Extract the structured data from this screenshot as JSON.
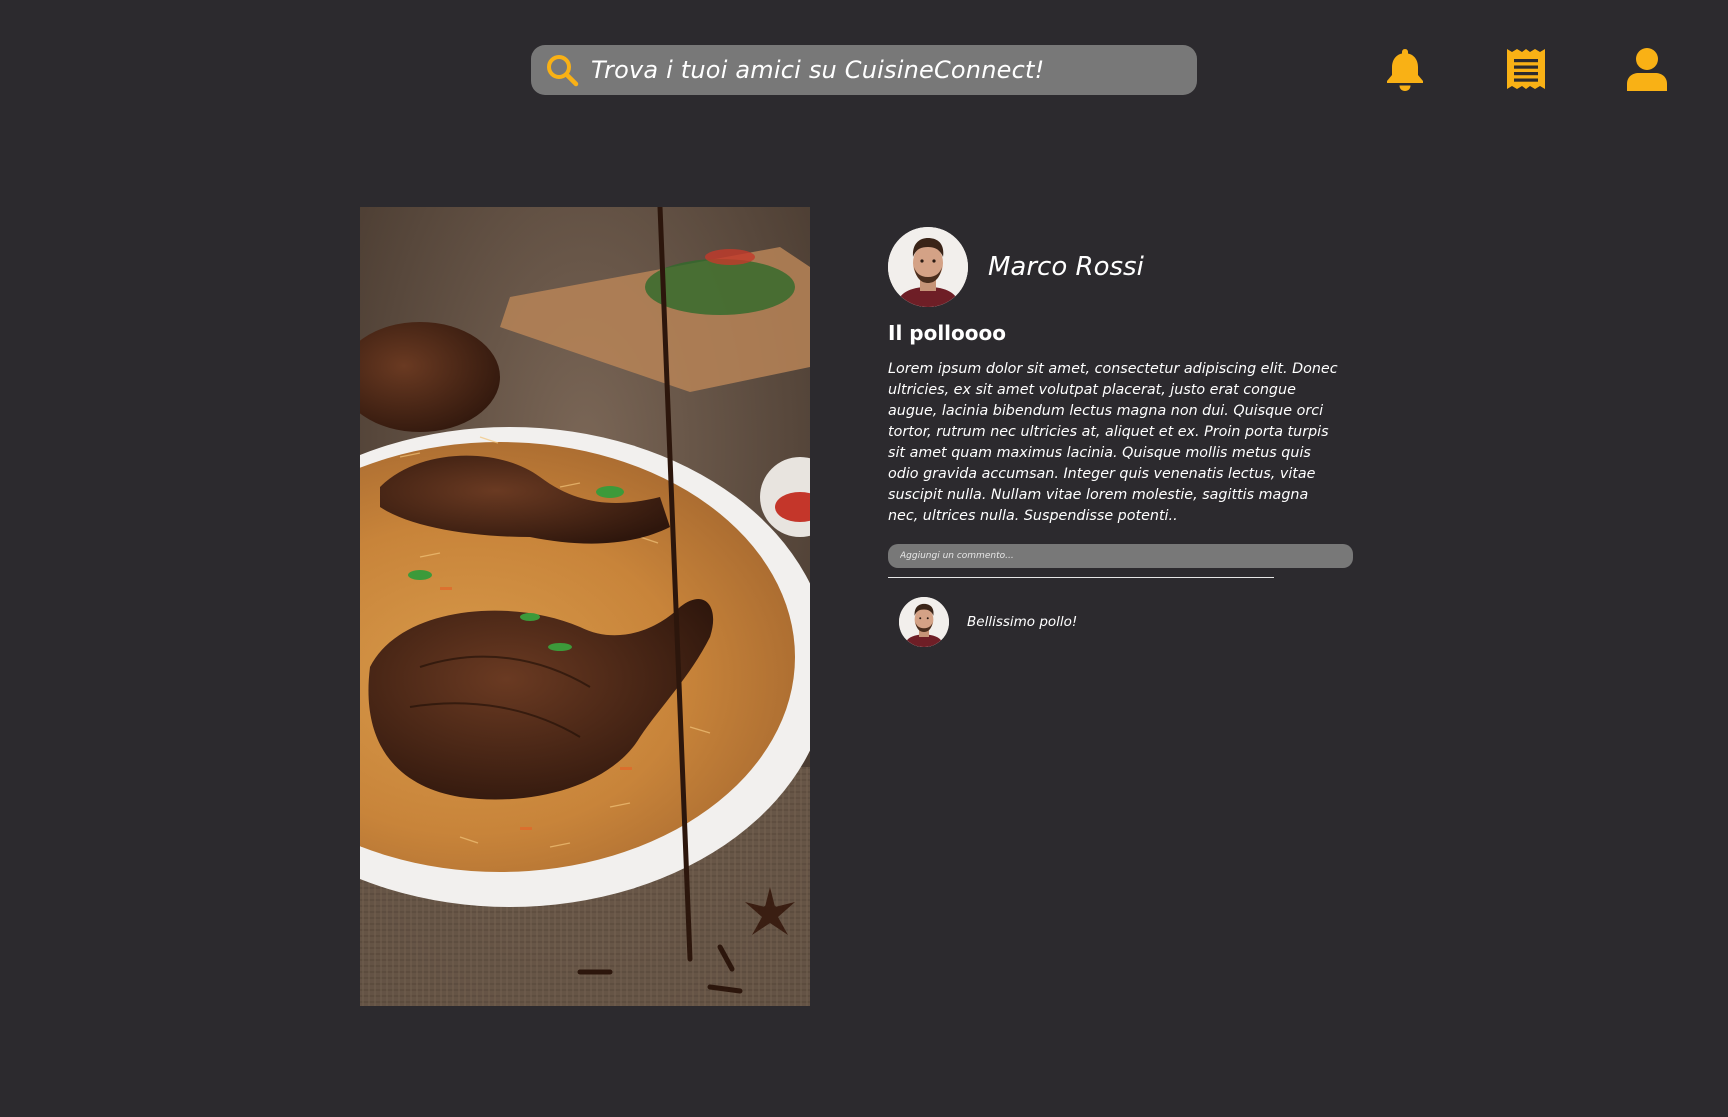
{
  "colors": {
    "background": "#2c2a2e",
    "accent": "#f9b115",
    "input_bg": "#787878",
    "text": "#ffffff"
  },
  "header": {
    "search": {
      "icon": "search-icon",
      "placeholder": "Trova i tuoi amici su CuisineConnect!"
    },
    "icons": [
      "bell-icon",
      "receipt-icon",
      "user-icon"
    ]
  },
  "post": {
    "image": "chicken-biryani-photo",
    "author": {
      "name": "Marco Rossi",
      "avatar": "avatar"
    },
    "title": "Il polloooo",
    "body": "Lorem ipsum dolor sit amet, consectetur adipiscing elit. Donec ultricies, ex sit amet volutpat placerat, justo erat congue augue, lacinia bibendum lectus magna non dui. Quisque orci tortor, rutrum nec ultricies at, aliquet et ex. Proin porta turpis sit amet quam maximus lacinia. Quisque mollis metus quis odio gravida accumsan. Integer quis venenatis lectus, vitae suscipit nulla. Nullam vitae lorem molestie, sagittis magna nec, ultrices nulla. Suspendisse potenti..",
    "comment_input": {
      "placeholder": "Aggiungi un commento..."
    },
    "comments": [
      {
        "text": "Bellissimo pollo!"
      }
    ]
  }
}
